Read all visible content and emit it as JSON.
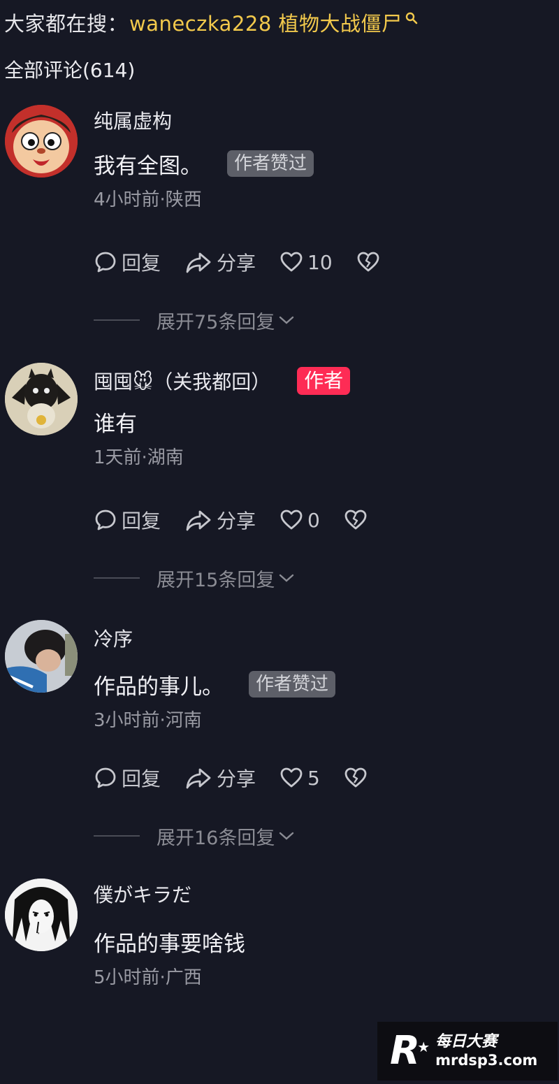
{
  "search_bar": {
    "label": "大家都在搜：",
    "query": "waneczka228 植物大战僵尸",
    "icon": "search-icon"
  },
  "comments_header": {
    "title": "全部评论(614)"
  },
  "comments": [
    {
      "username": "纯属虚构",
      "text": "我有全图。",
      "tag": "作者赞过",
      "meta": "4小时前·陕西",
      "reply_label": "回复",
      "share_label": "分享",
      "likes": "10",
      "expand_label": "展开75条回复"
    },
    {
      "username": "囤囤🐭（关我都回）",
      "author_tag": "作者",
      "text": "谁有",
      "meta": "1天前·湖南",
      "reply_label": "回复",
      "share_label": "分享",
      "likes": "0",
      "expand_label": "展开15条回复"
    },
    {
      "username": "冷序",
      "text": "作品的事儿。",
      "tag": "作者赞过",
      "meta": "3小时前·河南",
      "reply_label": "回复",
      "share_label": "分享",
      "likes": "5",
      "expand_label": "展开16条回复"
    },
    {
      "username": "僕がキラだ",
      "text": "作品的事要啥钱",
      "meta": "5小时前·广西"
    }
  ],
  "watermark": {
    "logo_letter": "R",
    "name": "每日大赛",
    "url": "mrdsp3.com"
  },
  "colors": {
    "background": "#161824",
    "search_query": "#f2c94c",
    "author_badge": "#fe2c55",
    "liked_badge": "#5d5f68"
  }
}
